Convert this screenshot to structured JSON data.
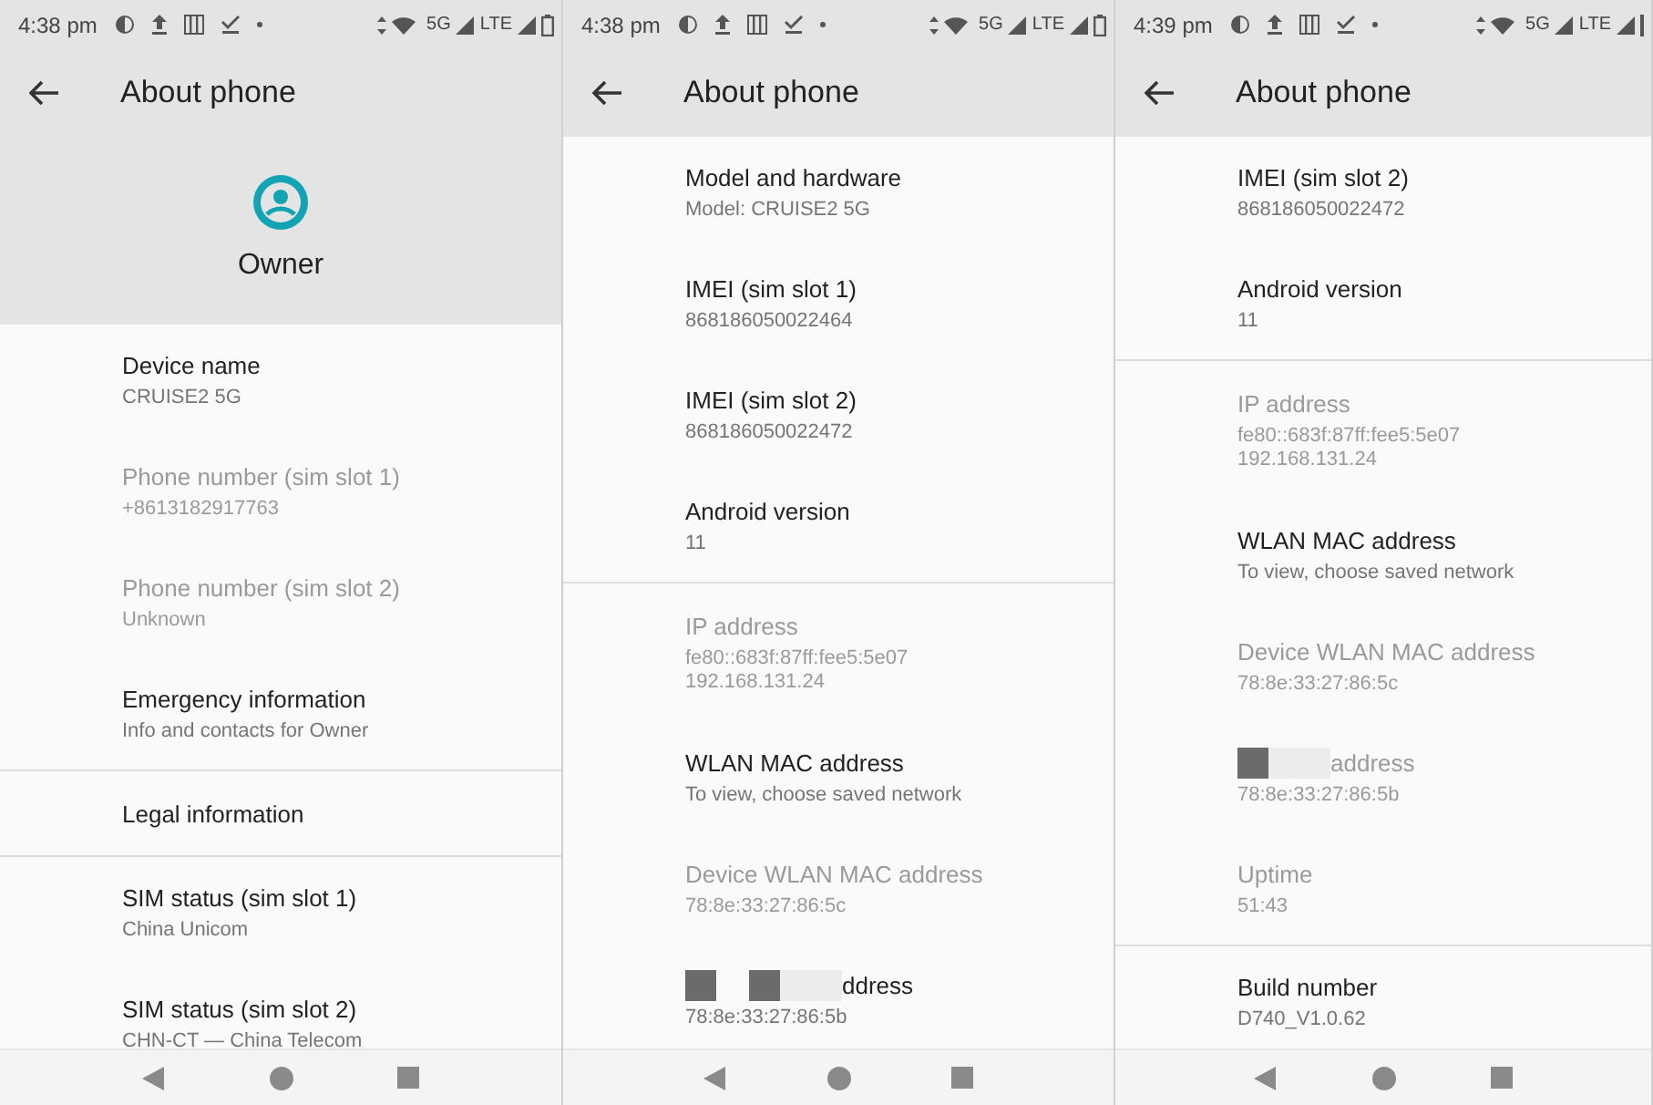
{
  "panels": [
    {
      "status_bar": {
        "time": "4:38 pm",
        "network_1": "5G",
        "network_2": "LTE",
        "battery": true
      },
      "app_bar": {
        "title": "About phone"
      },
      "header": {
        "name": "Owner"
      },
      "items": [
        {
          "kind": "setting",
          "title": "Device name",
          "summary": [
            "CRUISE2 5G"
          ],
          "disabled": false
        },
        {
          "kind": "setting",
          "title": "Phone number (sim slot 1)",
          "summary": [
            "+8613182917763"
          ],
          "disabled": true
        },
        {
          "kind": "setting",
          "title": "Phone number (sim slot 2)",
          "summary": [
            "Unknown"
          ],
          "disabled": true
        },
        {
          "kind": "setting",
          "title": "Emergency information",
          "summary": [
            "Info and contacts for Owner"
          ],
          "disabled": false
        },
        {
          "kind": "divider"
        },
        {
          "kind": "setting",
          "title": "Legal information",
          "disabled": false
        },
        {
          "kind": "divider"
        },
        {
          "kind": "setting",
          "title": "SIM status (sim slot 1)",
          "summary": [
            "China Unicom"
          ],
          "disabled": false
        },
        {
          "kind": "setting",
          "title": "SIM status (sim slot 2)",
          "summary": [
            "CHN-CT — China Telecom"
          ],
          "disabled": false
        }
      ]
    },
    {
      "status_bar": {
        "time": "4:38 pm",
        "network_1": "5G",
        "network_2": "LTE",
        "battery": true
      },
      "app_bar": {
        "title": "About phone"
      },
      "items": [
        {
          "kind": "setting",
          "title": "Model and hardware",
          "summary": [
            "Model: CRUISE2 5G"
          ],
          "disabled": false
        },
        {
          "kind": "setting",
          "title": "IMEI (sim slot 1)",
          "summary": [
            "868186050022464"
          ],
          "disabled": false
        },
        {
          "kind": "setting",
          "title": "IMEI (sim slot 2)",
          "summary": [
            "868186050022472"
          ],
          "disabled": false
        },
        {
          "kind": "setting",
          "title": "Android version",
          "summary": [
            "11"
          ],
          "disabled": false
        },
        {
          "kind": "divider"
        },
        {
          "kind": "setting",
          "title": "IP address",
          "summary": [
            "fe80::683f:87ff:fee5:5e07",
            "192.168.131.24"
          ],
          "disabled": true
        },
        {
          "kind": "setting",
          "title": "WLAN MAC address",
          "summary": [
            "To view, choose saved network"
          ],
          "disabled": false
        },
        {
          "kind": "setting",
          "title": "Device WLAN MAC address",
          "summary": [
            "78:8e:33:27:86:5c"
          ],
          "disabled": true
        },
        {
          "kind": "redacted",
          "redactions": [
            {
              "kind": "dark"
            },
            {
              "kind": "gap"
            },
            {
              "kind": "dark"
            },
            {
              "kind": "light"
            }
          ],
          "title": "ddress",
          "summary": [
            "78:8e:33:27:86:5b"
          ],
          "disabled": false
        }
      ]
    },
    {
      "status_bar": {
        "time": "4:39 pm",
        "network_1": "5G",
        "network_2": "LTE",
        "battery": false
      },
      "app_bar": {
        "title": "About phone"
      },
      "items": [
        {
          "kind": "setting",
          "title": "IMEI (sim slot 2)",
          "summary": [
            "868186050022472"
          ],
          "disabled": false
        },
        {
          "kind": "setting",
          "title": "Android version",
          "summary": [
            "11"
          ],
          "disabled": false
        },
        {
          "kind": "divider"
        },
        {
          "kind": "setting",
          "title": "IP address",
          "summary": [
            "fe80::683f:87ff:fee5:5e07",
            "192.168.131.24"
          ],
          "disabled": true
        },
        {
          "kind": "setting",
          "title": "WLAN MAC address",
          "summary": [
            "To view, choose saved network"
          ],
          "disabled": false
        },
        {
          "kind": "setting",
          "title": "Device WLAN MAC address",
          "summary": [
            "78:8e:33:27:86:5c"
          ],
          "disabled": true
        },
        {
          "kind": "redacted",
          "redactions": [
            {
              "kind": "dark"
            },
            {
              "kind": "light"
            }
          ],
          "title": "address",
          "summary": [
            "78:8e:33:27:86:5b"
          ],
          "disabled": true
        },
        {
          "kind": "setting",
          "title": "Uptime",
          "summary": [
            "51:43"
          ],
          "disabled": true
        },
        {
          "kind": "divider"
        },
        {
          "kind": "setting",
          "title": "Build number",
          "summary": [
            "D740_V1.0.62"
          ],
          "disabled": false
        }
      ]
    }
  ]
}
